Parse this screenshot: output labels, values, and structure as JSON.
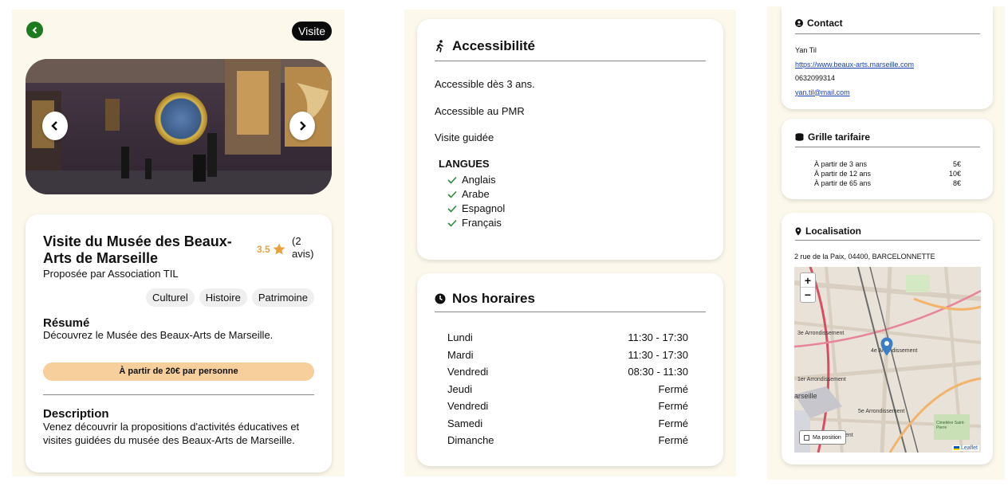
{
  "panel1": {
    "tag": "Visite",
    "title": "Visite du Musée des Beaux-Arts de Marseille",
    "rating": "3.5",
    "reviews": "(2 avis)",
    "organizer": "Proposée par Association TIL",
    "chips": [
      "Culturel",
      "Histoire",
      "Patrimoine"
    ],
    "summary_heading": "Résumé",
    "summary_text": "Découvrez le Musée des Beaux-Arts de Marseille.",
    "price": "À partir de 20€ par personne",
    "description_heading": "Description",
    "description_text": "Venez découvrir la propositions d'activités éducatives et visites guidées du musée des Beaux-Arts de Marseille.",
    "colors": {
      "back": "#1d7a1f",
      "price_bar": "#f6cf9c",
      "star": "#e8a33d"
    }
  },
  "accessibility": {
    "heading": "Accessibilité",
    "lines": [
      "Accessible dès 3 ans.",
      "Accessible au PMR",
      "Visite guidée"
    ],
    "languages_heading": "LANGUES",
    "languages": [
      "Anglais",
      "Arabe",
      "Espagnol",
      "Français"
    ]
  },
  "hours": {
    "heading": "Nos horaires",
    "rows": [
      {
        "day": "Lundi",
        "time": "11:30 - 17:30"
      },
      {
        "day": "Mardi",
        "time": "11:30 - 17:30"
      },
      {
        "day": "Vendredi",
        "time": "08:30 - 11:30"
      },
      {
        "day": "Jeudi",
        "time": "Fermé"
      },
      {
        "day": "Vendredi",
        "time": "Fermé"
      },
      {
        "day": "Samedi",
        "time": "Fermé"
      },
      {
        "day": "Dimanche",
        "time": "Fermé"
      }
    ]
  },
  "contact": {
    "heading": "Contact",
    "name": "Yan Til",
    "website": "https://www.beaux-arts.marseille.com",
    "phone": "0632099314",
    "email": "yan.til@mail.com"
  },
  "pricing": {
    "heading": "Grille tarifaire",
    "rows": [
      {
        "label": "À partir de 3 ans",
        "price": "5€"
      },
      {
        "label": "À partir de 12 ans",
        "price": "10€"
      },
      {
        "label": "À partir de 65 ans",
        "price": "8€"
      }
    ]
  },
  "location": {
    "heading": "Localisation",
    "address": "2 rue de la Paix, 04400, BARCELONNETTE",
    "zoom_in": "+",
    "zoom_out": "−",
    "my_position": "Ma position",
    "attribution": "Leaflet",
    "map_labels": [
      "3e Arrondissement",
      "4e Arrondissement",
      "1er Arrondissement",
      "arseille",
      "5e Arrondissement",
      "ment",
      "Cimetière Saint-Pierre"
    ]
  }
}
